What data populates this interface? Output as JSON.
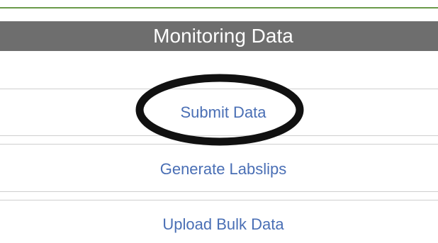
{
  "section": {
    "title": "Monitoring Data"
  },
  "links": {
    "submit": "Submit Data",
    "labslips": "Generate Labslips",
    "bulk": "Upload Bulk Data"
  },
  "colors": {
    "accent_rule": "#6a9a4a",
    "header_bg": "#6e6e6e",
    "link": "#4a6fb5",
    "annotation": "#111111"
  }
}
